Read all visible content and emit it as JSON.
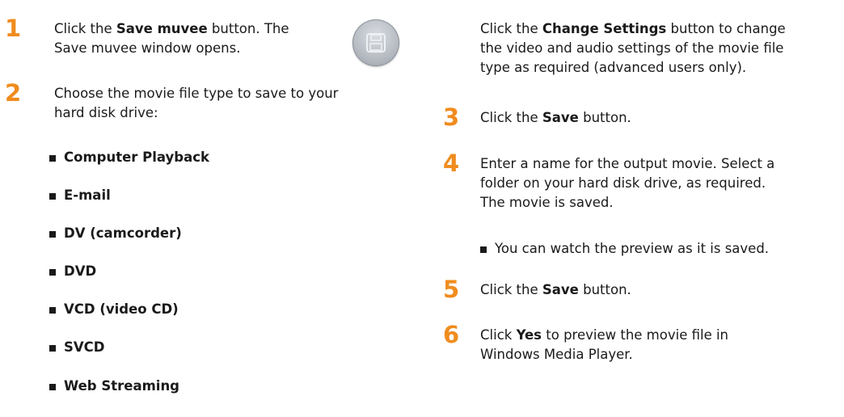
{
  "left": {
    "step1": {
      "num": "1",
      "line1_prefix": "Click the ",
      "line1_bold": "Save muvee",
      "line1_suffix": " button. The",
      "line2": "Save muvee window opens.",
      "icon": "save-muvee-icon"
    },
    "step2": {
      "num": "2",
      "line1": "Choose the movie file type to save to your",
      "line2": "hard disk drive:"
    },
    "file_types": [
      "Computer Playback",
      "E-mail",
      "DV (camcorder)",
      "DVD",
      "VCD (video CD)",
      "SVCD",
      "Web Streaming"
    ]
  },
  "right": {
    "intro": {
      "line1_prefix": "Click the ",
      "line1_bold": "Change Settings",
      "line1_suffix": " button to change",
      "line2": "the video and audio settings of the movie file",
      "line3": "type as required (advanced users only)."
    },
    "step3": {
      "num": "3",
      "prefix": "Click the ",
      "bold": "Save",
      "suffix": " button."
    },
    "step4": {
      "num": "4",
      "line1": "Enter a name for the output movie. Select a",
      "line2": "folder on your hard disk drive, as required.",
      "line3": "The movie is saved.",
      "bullet": "You can watch the preview as it is saved."
    },
    "step5": {
      "num": "5",
      "prefix": "Click the ",
      "bold": "Save",
      "suffix": " button."
    },
    "step6": {
      "num": "6",
      "prefix": "Click ",
      "bold": "Yes",
      "suffix": " to preview the movie file in",
      "line2": "Windows Media Player."
    }
  },
  "colors": {
    "step_number": "#f08c1e",
    "text": "#1a1a1a"
  }
}
